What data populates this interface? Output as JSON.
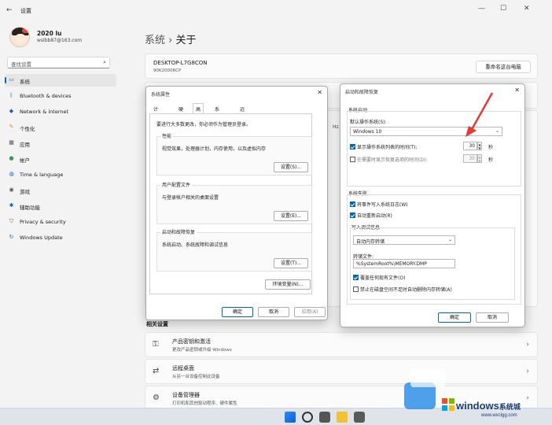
{
  "window": {
    "title": "设置",
    "minimize": "—",
    "maximize": "☐",
    "close": "✕",
    "back": "←"
  },
  "user": {
    "name": "2020 lu",
    "email": "wslbb87@163.com"
  },
  "search": {
    "placeholder": "查找设置",
    "icon": "search-icon"
  },
  "sidebar": {
    "items": [
      {
        "label": "系统",
        "icon": "monitor-icon",
        "active": true
      },
      {
        "label": "Bluetooth & devices",
        "icon": "bluetooth-icon"
      },
      {
        "label": "Network & internet",
        "icon": "wifi-icon"
      },
      {
        "label": "个性化",
        "icon": "brush-icon"
      },
      {
        "label": "应用",
        "icon": "apps-icon"
      },
      {
        "label": "帐户",
        "icon": "person-icon"
      },
      {
        "label": "Time & language",
        "icon": "globe-icon"
      },
      {
        "label": "游戏",
        "icon": "gamepad-icon"
      },
      {
        "label": "辅助功能",
        "icon": "accessibility-icon"
      },
      {
        "label": "Privacy & security",
        "icon": "shield-icon"
      },
      {
        "label": "Windows Update",
        "icon": "update-icon"
      }
    ]
  },
  "main": {
    "breadcrumb_root": "系统",
    "breadcrumb_sep": "›",
    "page_title": "关于",
    "device_name": "DESKTOP-L7G8CON",
    "device_model": "90K20006CP",
    "rename_button": "重命名这台电脑",
    "related_title": "相关设置",
    "related": [
      {
        "title": "产品密钥和激活",
        "subtitle": "更改产品密钥或升级 Windows",
        "icon": "key-icon"
      },
      {
        "title": "远程桌面",
        "subtitle": "从另一台设备控制此设备",
        "icon": "remote-icon"
      },
      {
        "title": "设备管理器",
        "subtitle": "打印机和其他驱动程序、硬件属性",
        "icon": "device-manager-icon"
      }
    ],
    "partial_hz": "Hz"
  },
  "sysprops": {
    "title": "系统属性",
    "close": "✕",
    "tabs": [
      "计算机名",
      "硬件",
      "高级",
      "系统保护",
      "远程"
    ],
    "active_tab": "高级",
    "admin_note": "要进行大多数更改，你必须作为管理员登录。",
    "groups": [
      {
        "title": "性能",
        "desc": "视觉效果，处理器计划，内存使用，以及虚拟内存",
        "button": "设置(S)..."
      },
      {
        "title": "用户配置文件",
        "desc": "与登录帐户相关的桌面设置",
        "button": "设置(E)..."
      },
      {
        "title": "启动和故障恢复",
        "desc": "系统启动、系统故障和调试信息",
        "button": "设置(T)..."
      }
    ],
    "env_button": "环境变量(N)...",
    "ok": "确定",
    "cancel": "取消",
    "apply": "应用(A)"
  },
  "startup": {
    "title": "启动和故障恢复",
    "close": "✕",
    "boot_section": "系统启动",
    "default_os_label": "默认操作系统(S):",
    "default_os_value": "Windows 10",
    "show_list_label": "显示操作系统列表的时间(T):",
    "show_list_checked": true,
    "show_list_value": "30",
    "show_recovery_label": "在需要时显示恢复选项的时间(D):",
    "show_recovery_checked": false,
    "show_recovery_value": "30",
    "seconds": "秒",
    "failure_section": "系统失败",
    "write_log_label": "将事件写入系统日志(W)",
    "write_log_checked": true,
    "auto_restart_label": "自动重新启动(R)",
    "auto_restart_checked": true,
    "debug_section": "写入调试信息",
    "debug_type": "自动内存转储",
    "dump_file_label": "转储文件:",
    "dump_file_value": "%SystemRoot%\\MEMORY.DMP",
    "overwrite_label": "覆盖任何现有文件(O)",
    "overwrite_checked": true,
    "disable_auto_delete_label": "禁止在磁盘空间不足时自动删除内存转储(A)",
    "disable_auto_delete_checked": false,
    "ok": "确定",
    "cancel": "取消"
  },
  "watermark": {
    "brand": "windows",
    "cn": "系统城",
    "url": "www.wxclgg.com"
  },
  "colors": {
    "accent": "#0067c0",
    "arrow": "#e53935"
  }
}
